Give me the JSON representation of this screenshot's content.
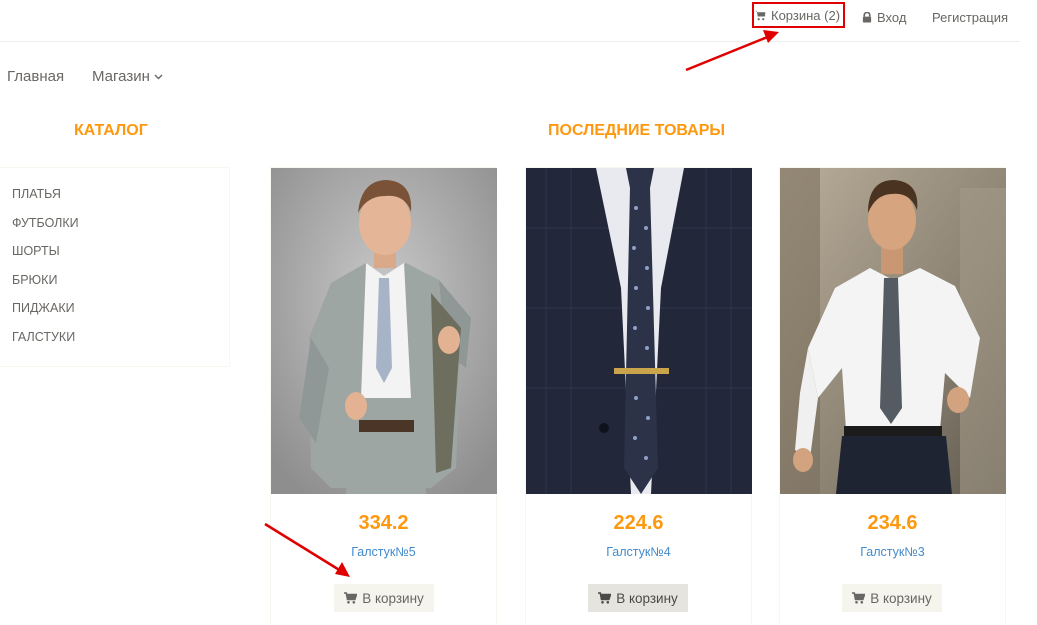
{
  "header": {
    "cart_label": "Корзина (2)",
    "login_label": "Вход",
    "register_label": "Регистрация"
  },
  "nav": {
    "home_label": "Главная",
    "shop_label": "Магазин"
  },
  "catalog": {
    "title": "Каталог",
    "items": [
      "Платья",
      "Футболки",
      "Шорты",
      "Брюки",
      "Пиджаки",
      "Галстуки"
    ]
  },
  "latest": {
    "title": "Последние товары",
    "products": [
      {
        "price": "334.2",
        "name": "Галстук№5",
        "button_label": "В корзину"
      },
      {
        "price": "224.6",
        "name": "Галстук№4",
        "button_label": "В корзину"
      },
      {
        "price": "234.6",
        "name": "Галстук№3",
        "button_label": "В корзину"
      }
    ]
  },
  "colors": {
    "accent": "#fe980f",
    "link": "#428bca",
    "text": "#696763",
    "annotation": "#e00000"
  }
}
